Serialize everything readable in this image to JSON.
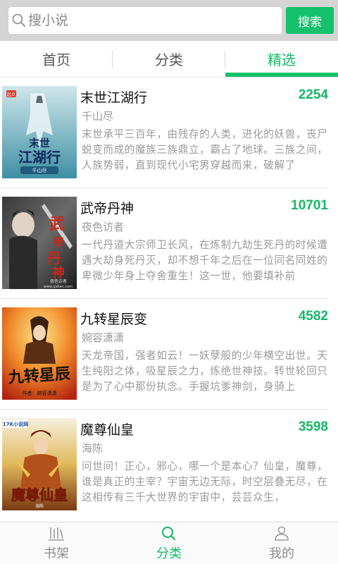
{
  "search": {
    "placeholder": "搜小说",
    "button_label": "搜索"
  },
  "tabs": [
    {
      "label": "首页",
      "active": false
    },
    {
      "label": "分类",
      "active": false
    },
    {
      "label": "精选",
      "active": true
    }
  ],
  "books": [
    {
      "title": "末世江湖行",
      "count": "2254",
      "author": "千山尽",
      "description": "末世承平三百年，由残存的人类，进化的妖兽，丧尸蜕变而成的魔族三族鼎立，霸占了地球。三族之间，人族势弱，直到现代小宅男穿越而来，破解了",
      "cover_text": "末世江湖行",
      "cover_author": "千山尽",
      "cover_badge": "起点"
    },
    {
      "title": "武帝丹神",
      "count": "10701",
      "author": "夜色访者",
      "description": "一代丹道大宗师卫长风，在炼制九劫生死丹的时候遭遇大劫身死丹灭，却不想千年之后在一位同名同姓的卑微少年身上夺舍重生！这一世，他要填补前",
      "cover_text": "武帝丹神",
      "cover_author": "夜色访者",
      "cover_site": "www.qidian.com"
    },
    {
      "title": "九转星辰变",
      "count": "4582",
      "author": "婉容潇潇",
      "description": "天龙帝国，强者如云！一妖孽般的少年横空出世。天生纯阳之体，吸星辰之力，练绝世神技。转世轮回只是为了心中那份执念。手握坑爹神剑，身骑上",
      "cover_text": "九转星辰变",
      "cover_author": "作者：婉容潇潇"
    },
    {
      "title": "魔尊仙皇",
      "count": "3598",
      "author": "海陈",
      "description": "问世间！正心，邪心，哪一个是本心？仙皇，魔尊，谁是真正的主宰？宇宙无边无际，时空层叠无尽，在这相传有三千大世界的宇宙中，芸芸众生，",
      "cover_text": "魔尊仙皇",
      "cover_author": "海陈",
      "cover_badge": "17K小说网"
    }
  ],
  "bottom_nav": [
    {
      "label": "书架",
      "icon": "bookshelf-icon",
      "active": false
    },
    {
      "label": "分类",
      "icon": "search-icon",
      "active": true
    },
    {
      "label": "我的",
      "icon": "profile-icon",
      "active": false
    }
  ],
  "colors": {
    "accent": "#15c16a",
    "accent_text": "#15b866",
    "muted_text": "#9a9a9a"
  }
}
